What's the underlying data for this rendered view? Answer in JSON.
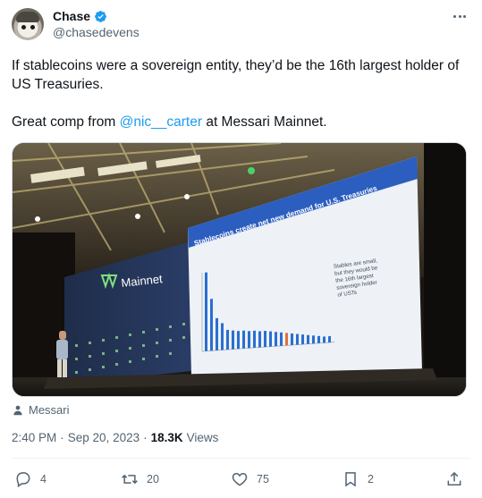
{
  "author": {
    "display_name": "Chase",
    "handle": "@chasedevens",
    "verified": true
  },
  "tweet": {
    "line1": "If stablecoins were a sovereign entity, they’d be the 16th largest holder of US Treasuries.",
    "line2_prefix": "Great comp from ",
    "line2_mention": "@nic__carter",
    "line2_suffix": " at Messari Mainnet."
  },
  "media": {
    "stage_logo": "Mainnet",
    "slide_title": "Stablecoins create net new demand for U.S. Treasuries",
    "slide_caption_lines": [
      "Stables are small,",
      "but they would be",
      "the 16th largest",
      "sovereign holder",
      "of USTs"
    ],
    "bar_color": "#2a6fcf",
    "highlight_color": "#e0713a"
  },
  "location": "Messari",
  "meta": {
    "time": "2:40 PM",
    "separator": "·",
    "date": "Sep 20, 2023",
    "views_count": "18.3K",
    "views_label": "Views"
  },
  "actions": {
    "replies": "4",
    "retweets": "20",
    "likes": "75",
    "bookmarks": "2"
  },
  "colors": {
    "accent": "#1d9bf0",
    "secondary_text": "#536471"
  }
}
